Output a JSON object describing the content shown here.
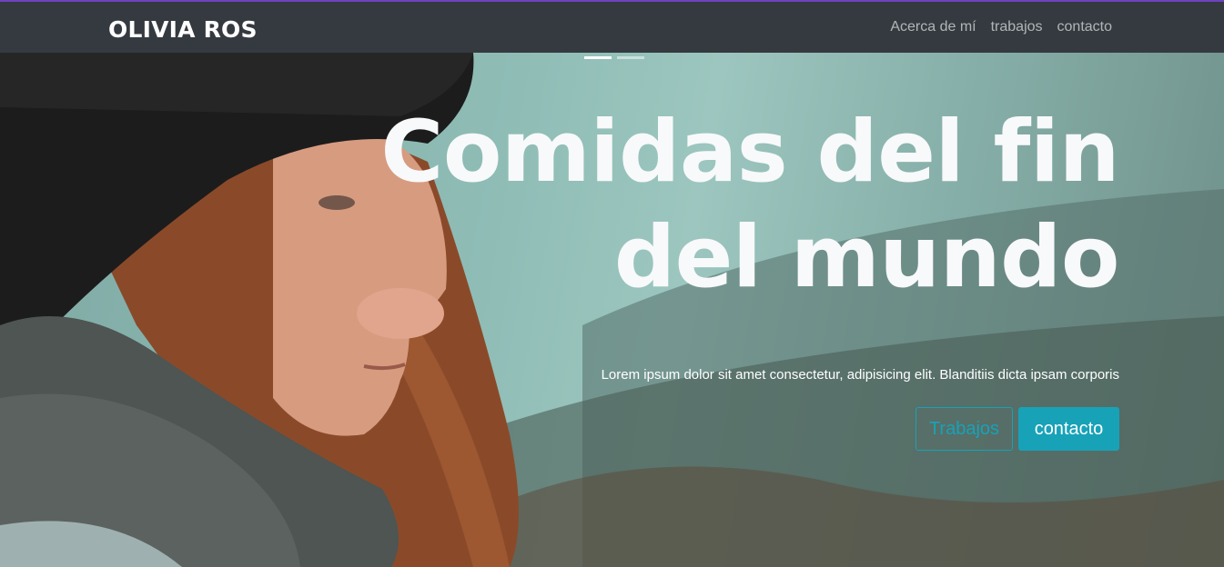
{
  "navbar": {
    "brand": "OLIVIA ROS",
    "links": [
      "Acerca de mí",
      "trabajos",
      "contacto"
    ]
  },
  "hero": {
    "title": "Comidas del fin del mundo",
    "lead": "Lorem ipsum dolor sit amet consectetur, adipisicing elit. Blanditiis dicta ipsam corporis",
    "buttons": {
      "outline": "Trabajos",
      "solid": "contacto"
    },
    "slides": 2,
    "active_slide": 1
  },
  "colors": {
    "navbar_bg": "#343a40",
    "accent_info": "#17a2b8",
    "top_border": "#6f42c1"
  }
}
